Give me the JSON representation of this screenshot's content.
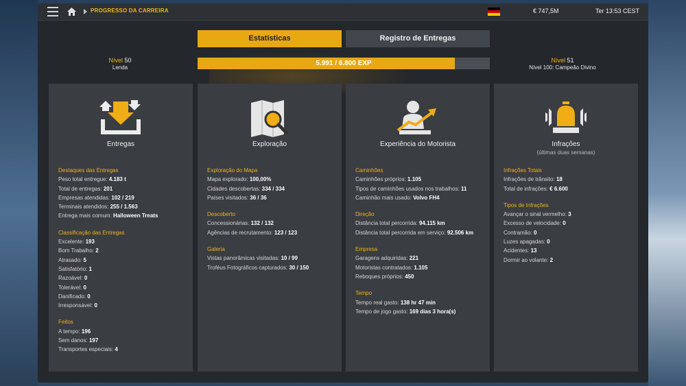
{
  "header": {
    "breadcrumb": "PROGRESSO DA CARREIRA",
    "money": "€ 747,5M",
    "time": "Ter 13:53 CEST"
  },
  "tabs": [
    {
      "label": "Estatísticas",
      "active": true
    },
    {
      "label": "Registro de Entregas",
      "active": false
    }
  ],
  "level": {
    "current_label": "Nível",
    "current_value": "50",
    "current_title": "Lenda",
    "next_label": "Nível",
    "next_value": "51",
    "next_title": "Nível 100: Campeão Divino",
    "xp_text": "5.991 / 6.800 EXP",
    "xp_progress": 0.881
  },
  "colors": {
    "accent": "#e8a814",
    "panel": "#3a3d42",
    "window": "#24272b"
  },
  "panels": [
    {
      "title": "Entregas",
      "icon": "delivery-icon",
      "sections": [
        {
          "title": "Destaques das Entregas",
          "rows": [
            {
              "label": "Peso total entregue:",
              "value": "4.183 t"
            },
            {
              "label": "Total de entregas:",
              "value": "201"
            },
            {
              "label": "Empresas atendidas:",
              "value": "102 / 219"
            },
            {
              "label": "Terminais atendidos:",
              "value": "255 / 1.563"
            },
            {
              "label": "Entrega mais comum:",
              "value": "Halloween Treats"
            }
          ]
        },
        {
          "title": "Classificação das Entregas",
          "rows": [
            {
              "label": "Excelente:",
              "value": "193"
            },
            {
              "label": "Bom Trabalho:",
              "value": "2"
            },
            {
              "label": "Atrasado:",
              "value": "5"
            },
            {
              "label": "Satisfatório:",
              "value": "1"
            },
            {
              "label": "Razoável:",
              "value": "0"
            },
            {
              "label": "Tolerável:",
              "value": "0"
            },
            {
              "label": "Danificado:",
              "value": "0"
            },
            {
              "label": "Irresponsável:",
              "value": "0"
            }
          ]
        },
        {
          "title": "Feitos",
          "rows": [
            {
              "label": "A tempo:",
              "value": "196"
            },
            {
              "label": "Sem danos:",
              "value": "197"
            },
            {
              "label": "Transportes especiais:",
              "value": "4"
            }
          ]
        }
      ]
    },
    {
      "title": "Exploração",
      "icon": "map-search-icon",
      "sections": [
        {
          "title": "Exploração do Mapa",
          "rows": [
            {
              "label": "Mapa explorado:",
              "value": "100,00%"
            },
            {
              "label": "Cidades descobertas:",
              "value": "334 / 334"
            },
            {
              "label": "Países visitados:",
              "value": "36 / 36"
            }
          ]
        },
        {
          "title": "Descoberto",
          "rows": [
            {
              "label": "Concessionárias:",
              "value": "132 / 132"
            },
            {
              "label": "Agências de recrutamento:",
              "value": "123 / 123"
            }
          ]
        },
        {
          "title": "Galeria",
          "rows": [
            {
              "label": "Vistas panorâmicas visitadas:",
              "value": "10 / 99"
            },
            {
              "label": "Troféus Fotográficos capturados:",
              "value": "30 / 150"
            }
          ]
        }
      ]
    },
    {
      "title": "Experiência do Motorista",
      "icon": "driver-growth-icon",
      "sections": [
        {
          "title": "Caminhões",
          "rows": [
            {
              "label": "Caminhões próprios:",
              "value": "1.105"
            },
            {
              "label": "Tipos de caminhões usados nos trabalhos:",
              "value": "11"
            },
            {
              "label": "Caminhão mais usado:",
              "value": "Volvo FH4"
            }
          ]
        },
        {
          "title": "Direção",
          "rows": [
            {
              "label": "Distância total percorrida:",
              "value": "94.115 km"
            },
            {
              "label": "Distância total percorrida em serviço:",
              "value": "92.506 km"
            }
          ]
        },
        {
          "title": "Empresa",
          "rows": [
            {
              "label": "Garagens adquiridas:",
              "value": "221"
            },
            {
              "label": "Motoristas contratados:",
              "value": "1.105"
            },
            {
              "label": "Reboques próprios:",
              "value": "450"
            }
          ]
        },
        {
          "title": "Tempo",
          "rows": [
            {
              "label": "Tempo real gasto:",
              "value": "138 hr 47 min"
            },
            {
              "label": "Tempo de jogo gasto:",
              "value": "169 dias 3 hora(s)"
            }
          ]
        }
      ]
    },
    {
      "title": "Infrações",
      "subtitle": "(últimas duas semanas)",
      "icon": "siren-icon",
      "sections": [
        {
          "title": "Infrações Totais",
          "rows": [
            {
              "label": "Infrações de trânsito:",
              "value": "18"
            },
            {
              "label": "Total de infrações:",
              "value": "€ 6.600"
            }
          ]
        },
        {
          "title": "Tipos de Infrações",
          "rows": [
            {
              "label": "Avançar o sinal vermelho:",
              "value": "3"
            },
            {
              "label": "Excesso de velocidade:",
              "value": "0"
            },
            {
              "label": "Contramão:",
              "value": "0"
            },
            {
              "label": "Luzes apagadas:",
              "value": "0"
            },
            {
              "label": "Acidentes:",
              "value": "13"
            },
            {
              "label": "Dormir ao volante:",
              "value": "2"
            }
          ]
        }
      ]
    }
  ]
}
